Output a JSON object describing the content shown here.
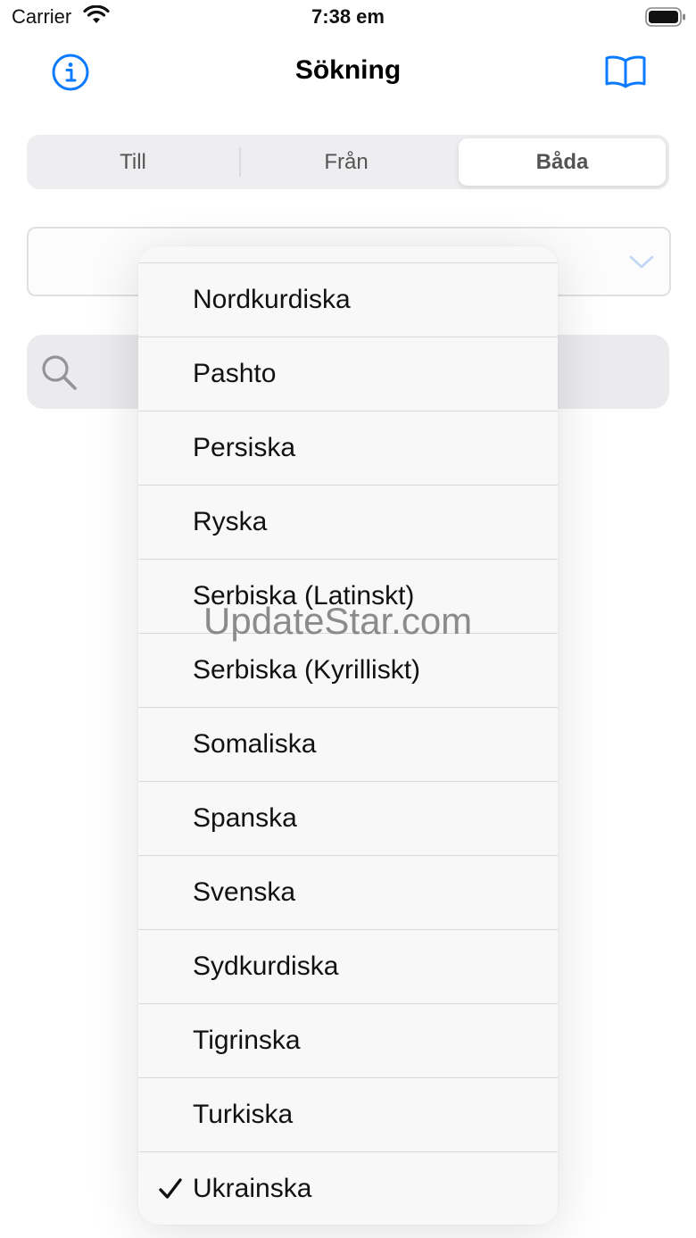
{
  "status_bar": {
    "carrier": "Carrier",
    "time": "7:38 em"
  },
  "nav": {
    "title": "Sökning",
    "left_icon": "info-icon",
    "right_icon": "book-icon"
  },
  "segments": {
    "items": [
      "Till",
      "Från",
      "Båda"
    ],
    "selected": "Båda"
  },
  "language_picker": {
    "value": "",
    "icon": "chevron-down-icon"
  },
  "search": {
    "icon": "search-icon",
    "placeholder": ""
  },
  "menu": {
    "items": [
      "Nordkurdiska",
      "Pashto",
      "Persiska",
      "Ryska",
      "Serbiska (Latinskt)",
      "Serbiska (Kyrilliskt)",
      "Somaliska",
      "Spanska",
      "Svenska",
      "Sydkurdiska",
      "Tigrinska",
      "Turkiska",
      "Ukrainska"
    ],
    "checked": "Ukrainska"
  },
  "watermark": "UpdateStar.com",
  "colors": {
    "accent": "#0a7aff",
    "background": "#ffffff",
    "menu_background": "#f8f8f8",
    "segment_track": "#e8e8ec"
  }
}
